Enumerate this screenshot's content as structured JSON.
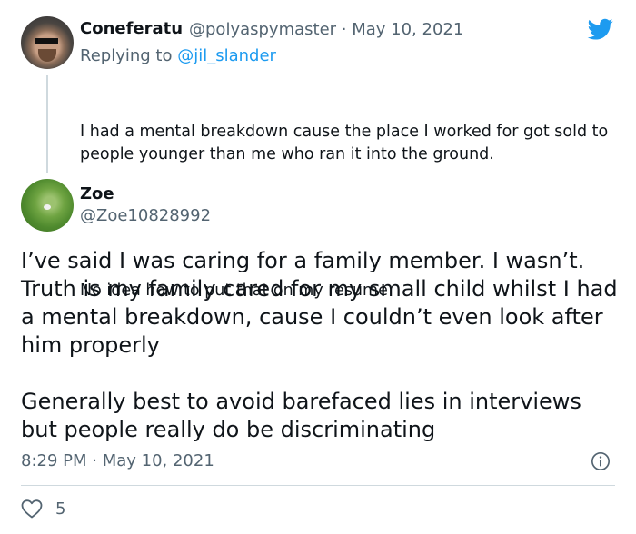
{
  "reply_to_tweet": {
    "display_name": "Coneferatu",
    "meta": "@polyaspymaster · May 10, 2021",
    "replying_prefix": "Replying to",
    "replying_handle": "@jil_slander",
    "paragraphs": [
      "I had a mental breakdown cause the place I worked for got sold to people younger than me who ran it into the ground.",
      "No idea how to put that on my resume"
    ]
  },
  "main_tweet": {
    "display_name": "Zoe",
    "handle": "@Zoe10828992",
    "paragraphs": [
      "I’ve said I was caring for a family member. I wasn’t. Truth is my family cared for my small child whilst I had a mental breakdown, cause I couldn’t even look after him properly",
      "Generally best to avoid barefaced lies in interviews but people really do be discriminating"
    ],
    "timestamp": "8:29 PM · May 10, 2021",
    "like_count": "5"
  },
  "icons": {
    "brand": "twitter-bird-icon",
    "info": "info-icon",
    "like": "heart-icon"
  },
  "colors": {
    "text": "#0f1419",
    "secondary": "#536471",
    "link": "#1d9bf0",
    "twitter_blue": "#1d9bf0",
    "divider": "#cfd9de"
  }
}
